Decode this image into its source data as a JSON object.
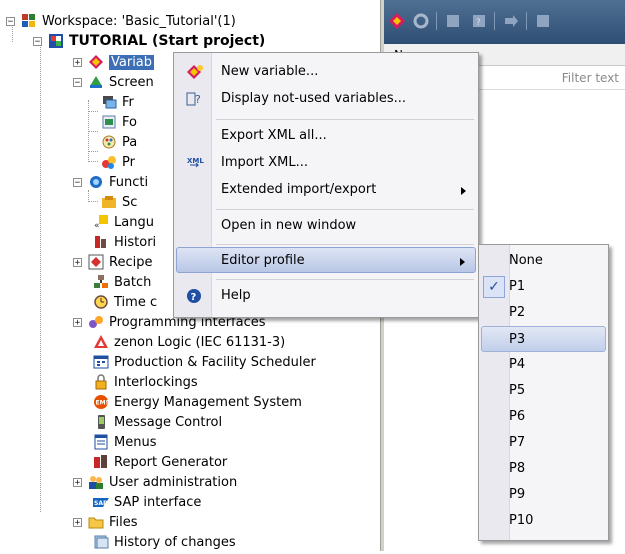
{
  "tree": {
    "workspace": "Workspace: 'Basic_Tutorial'(1)",
    "project": "TUTORIAL (Start project)",
    "items": {
      "variables": "Variab",
      "screens": "Screen",
      "screen_fr": "Fr",
      "screen_fo": "Fo",
      "screen_pa": "Pa",
      "screen_pr": "Pr",
      "functions": "Functi",
      "functions_sc": "Sc",
      "languages": "Langu",
      "historian": "Histori",
      "recipes": "Recipe",
      "batch": "Batch",
      "time": "Time c",
      "programming": "Programming interfaces",
      "zenon_logic": "zenon Logic (IEC 61131-3)",
      "production": "Production & Facility Scheduler",
      "interlockings": "Interlockings",
      "energy": "Energy Management System",
      "message": "Message Control",
      "menus": "Menus",
      "report": "Report Generator",
      "user_admin": "User administration",
      "sap": "SAP interface",
      "files": "Files",
      "history": "History of changes"
    }
  },
  "right_panel": {
    "column_header": "Name",
    "filter_placeholder": "Filter text"
  },
  "context_menu": {
    "items": {
      "new_variable": "New variable...",
      "display_unused": "Display not-used variables...",
      "export_xml": "Export XML all...",
      "import_xml": "Import XML...",
      "extended": "Extended import/export",
      "open_new_window": "Open in new window",
      "editor_profile": "Editor profile",
      "help": "Help"
    }
  },
  "submenu": {
    "selected": "P1",
    "highlighted": "P3",
    "items": [
      "None",
      "P1",
      "P2",
      "P3",
      "P4",
      "P5",
      "P6",
      "P7",
      "P8",
      "P9",
      "P10"
    ]
  },
  "colors": {
    "toolbar": "#3d5d84",
    "menu_highlight": "#c5d1ec",
    "menu_background": "#f5f5f7"
  }
}
